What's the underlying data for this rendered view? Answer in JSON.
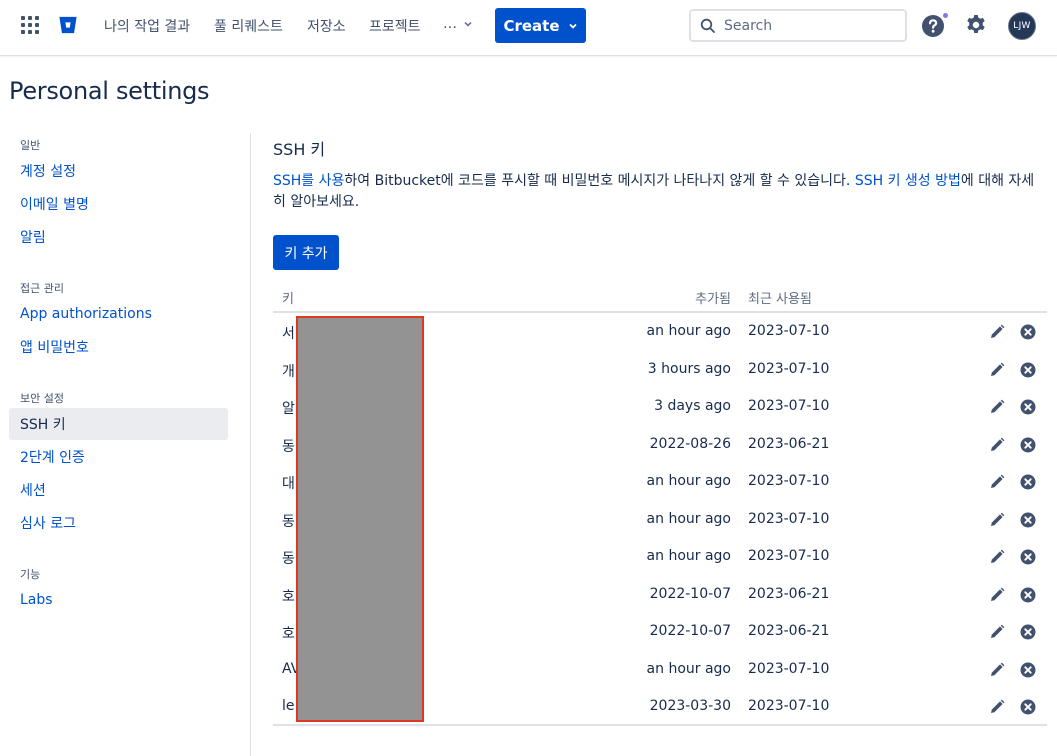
{
  "nav": {
    "items": [
      "나의 작업 결과",
      "풀 리퀘스트",
      "저장소",
      "프로젝트"
    ],
    "more_label": "…",
    "create_label": "Create",
    "search_placeholder": "Search",
    "avatar_initials": "LJW",
    "help_badge_color": "#8777d9"
  },
  "page_title": "Personal settings",
  "sidebar": {
    "groups": [
      {
        "label": "일반",
        "items": [
          "계정 설정",
          "이메일 별명",
          "알림"
        ]
      },
      {
        "label": "접근 관리",
        "items": [
          "App authorizations",
          "앱 비밀번호"
        ]
      },
      {
        "label": "보안 설정",
        "items": [
          "SSH 키",
          "2단계 인증",
          "세션",
          "심사 로그"
        ]
      },
      {
        "label": "기능",
        "items": [
          "Labs"
        ]
      }
    ],
    "active_item": "SSH 키"
  },
  "main": {
    "section_title": "SSH 키",
    "desc": {
      "link1": "SSH를 사용",
      "text1": "하여 Bitbucket에 코드를 푸시할 때 비밀번호 메시지가 나타나지 않게 할 수 있습니다. ",
      "link2": "SSH 키 생성 방법",
      "text2": "에 대해 자세히 알아보세요."
    },
    "add_button": "키 추가",
    "table": {
      "headers": {
        "key": "키",
        "added": "추가됨",
        "last_used": "최근 사용됨"
      },
      "rows": [
        {
          "key": "서",
          "added": "an hour ago",
          "last_used": "2023-07-10"
        },
        {
          "key": "개",
          "added": "3 hours ago",
          "last_used": "2023-07-10"
        },
        {
          "key": "알",
          "added": "3 days ago",
          "last_used": "2023-07-10"
        },
        {
          "key": "동",
          "added": "2022-08-26",
          "last_used": "2023-06-21"
        },
        {
          "key": "대",
          "added": "an hour ago",
          "last_used": "2023-07-10"
        },
        {
          "key": "동",
          "added": "an hour ago",
          "last_used": "2023-07-10"
        },
        {
          "key": "동",
          "added": "an hour ago",
          "last_used": "2023-07-10"
        },
        {
          "key": "호",
          "added": "2022-10-07",
          "last_used": "2023-06-21"
        },
        {
          "key": "호",
          "added": "2022-10-07",
          "last_used": "2023-06-21"
        },
        {
          "key": "AV",
          "added": "an hour ago",
          "last_used": "2023-07-10"
        },
        {
          "key": "le",
          "added": "2023-03-30",
          "last_used": "2023-07-10"
        }
      ]
    }
  },
  "colors": {
    "primary": "#0052cc",
    "text": "#172b4d",
    "redaction": "#939393",
    "redaction_border": "#e0371f"
  }
}
